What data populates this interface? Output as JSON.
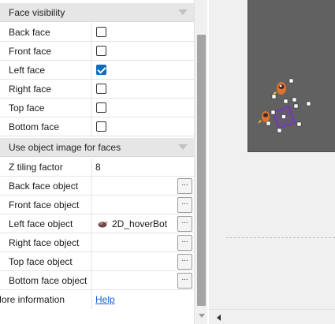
{
  "sections": {
    "face_visibility": {
      "title": "Face visibility"
    },
    "object_image": {
      "title": "Use object image for faces"
    }
  },
  "faces": [
    {
      "label": "Back face",
      "checked": false
    },
    {
      "label": "Front face",
      "checked": false
    },
    {
      "label": "Left face",
      "checked": true
    },
    {
      "label": "Right face",
      "checked": false
    },
    {
      "label": "Top face",
      "checked": false
    },
    {
      "label": "Bottom face",
      "checked": false
    }
  ],
  "z_tiling": {
    "label": "Z tiling factor",
    "value": "8"
  },
  "face_objects": [
    {
      "label": "Back face object",
      "value": ""
    },
    {
      "label": "Front face object",
      "value": ""
    },
    {
      "label": "Left face object",
      "value": "2D_hoverBot"
    },
    {
      "label": "Right face object",
      "value": ""
    },
    {
      "label": "Top face object",
      "value": ""
    },
    {
      "label": "Bottom face object",
      "value": ""
    }
  ],
  "browse_label": "...",
  "more_info": {
    "label": "More information",
    "link": "Help"
  },
  "colors": {
    "accent": "#0f6cbd",
    "link": "#1a5fd0",
    "canvas": "#616161",
    "selection": "#7a2fd0"
  }
}
